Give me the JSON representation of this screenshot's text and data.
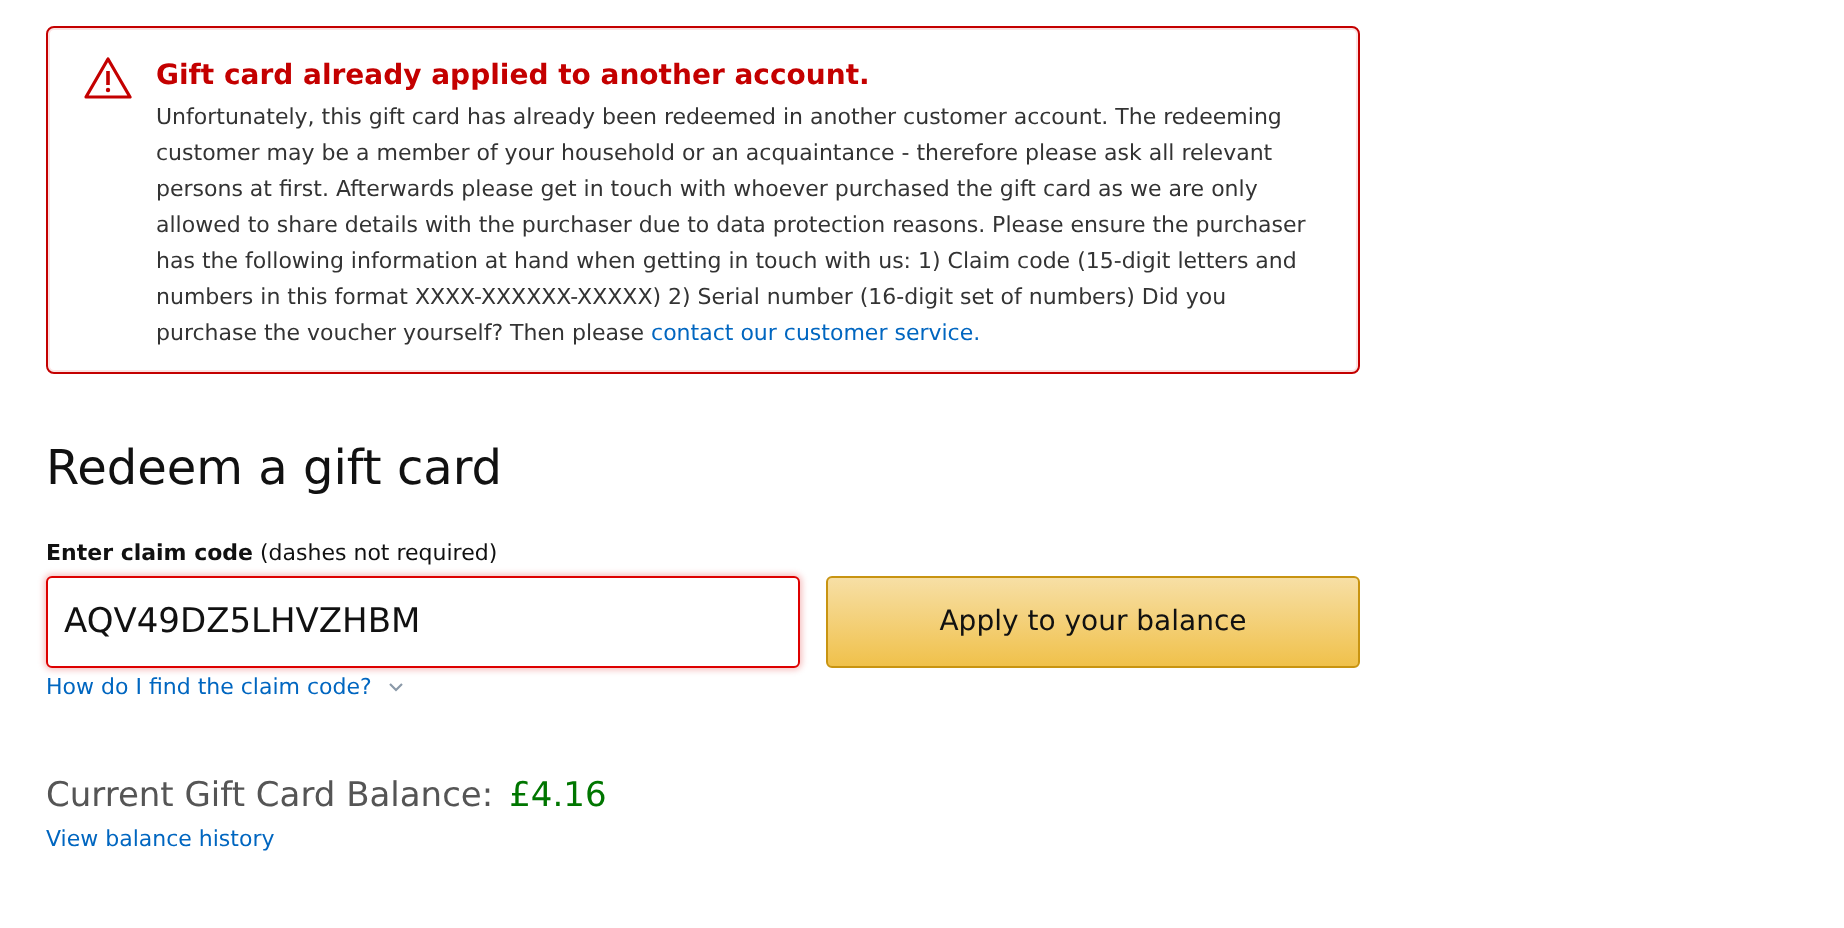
{
  "alert": {
    "title": "Gift card already applied to another account.",
    "text": "Unfortunately, this gift card has already been redeemed in another customer account. The redeeming customer may be a member of your household or an acquaintance - therefore please ask all relevant persons at first. Afterwards please get in touch with whoever purchased the gift card as we are only allowed to share details with the purchaser due to data protection reasons.  Please ensure the purchaser has the following information at hand when getting in touch with us: 1) Claim code (15-digit letters and numbers in this format XXXX-XXXXXX-XXXXX) 2) Serial number (16-digit set of numbers)  Did you purchase the voucher yourself? Then please",
    "link": "contact our customer service."
  },
  "heading": "Redeem a gift card",
  "claim": {
    "label": "Enter claim code",
    "hint": "(dashes not required)",
    "value": "AQV49DZ5LHVZHBM",
    "error": true,
    "help_link": "How do I find the claim code?",
    "help_expanded": false
  },
  "button": "Apply to your balance",
  "balance": {
    "label": "Current Gift Card Balance:",
    "amount": "£4.16",
    "history_link": "View balance history"
  }
}
